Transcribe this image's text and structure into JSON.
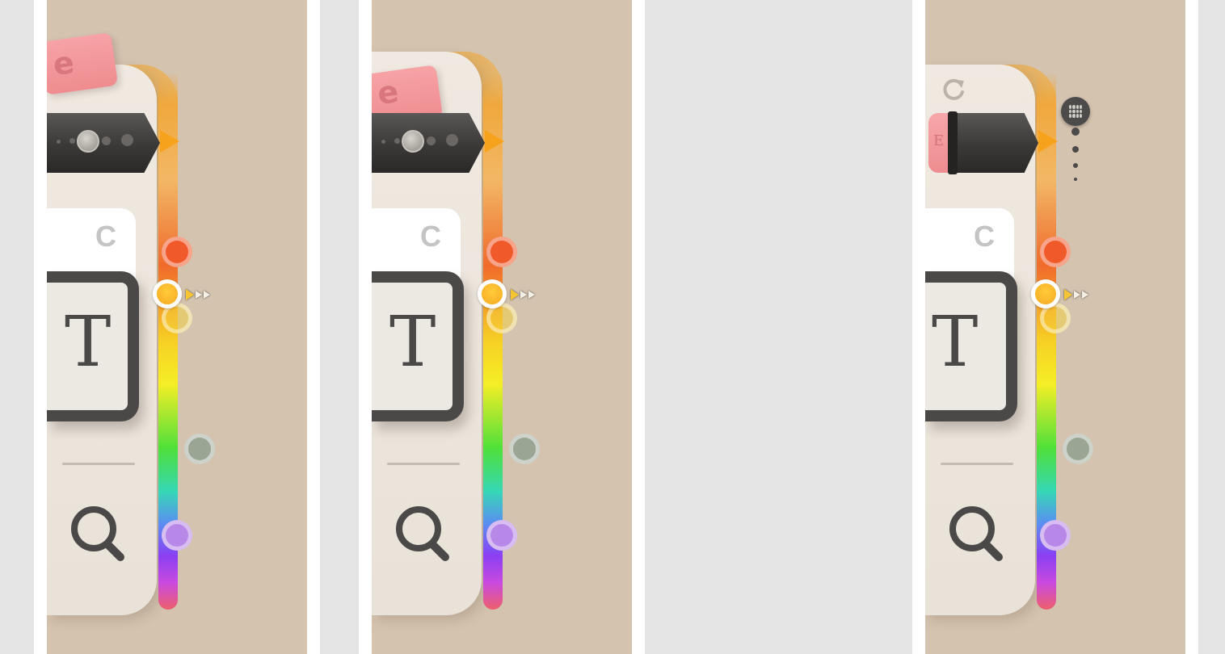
{
  "panels": [
    {
      "name": "panel-1",
      "eraser_letter": "e",
      "card_letter": "C",
      "text_tool_letter": "T"
    },
    {
      "name": "panel-2",
      "eraser_letter": "e",
      "card_letter": "C",
      "text_tool_letter": "T"
    },
    {
      "name": "panel-3",
      "pen_cap_letter": "E",
      "card_letter": "C",
      "text_tool_letter": "T"
    }
  ],
  "colors": {
    "background": "#d4c3af",
    "toolbar": "#ece5db",
    "pen_body": "#3b3937",
    "pen_tip": "#f7a21c",
    "active_swatch": "#f8b62a",
    "eraser": "#f29a9d",
    "text_tool_border": "#4a4948"
  },
  "icons": [
    "eraser-icon",
    "pen-icon",
    "text-tool-icon",
    "search-icon",
    "refresh-icon",
    "menu-grid-icon",
    "color-spectrum-slider"
  ]
}
